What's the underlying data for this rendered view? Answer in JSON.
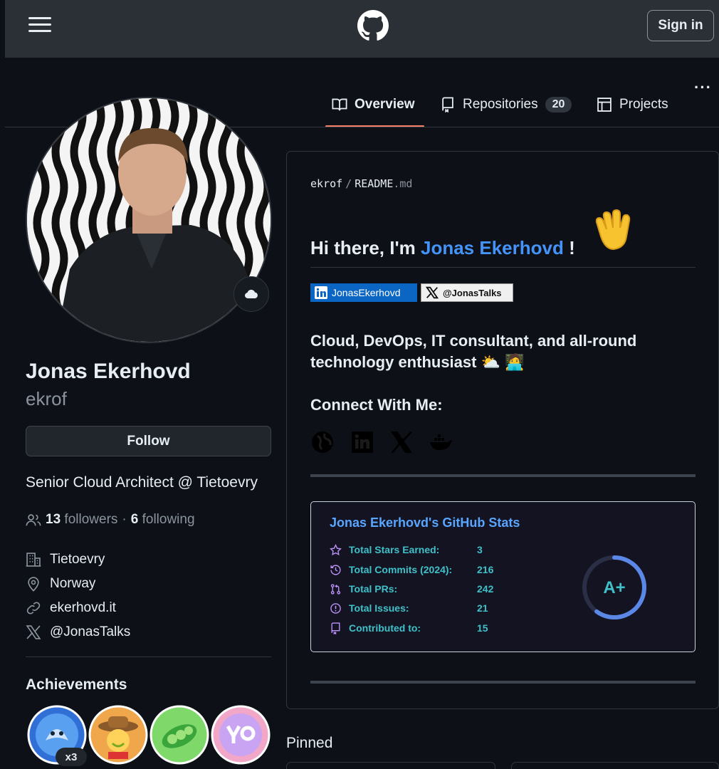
{
  "header": {
    "signin_label": "Sign in"
  },
  "tabs": [
    {
      "label": "Overview",
      "active": true,
      "icon": "book-icon"
    },
    {
      "label": "Repositories",
      "count": "20",
      "icon": "repo-icon"
    },
    {
      "label": "Projects",
      "icon": "table-icon"
    }
  ],
  "more_menu": "···",
  "profile": {
    "name": "Jonas Ekerhovd",
    "login": "ekrof",
    "follow_label": "Follow",
    "bio": "Senior Cloud Architect @ Tietoevry",
    "followers_count": "13",
    "followers_label": "followers",
    "dot": "·",
    "following_count": "6",
    "following_label": "following",
    "company": "Tietoevry",
    "location": "Norway",
    "website": "ekerhovd.it",
    "twitter": "@JonasTalks",
    "achievements_title": "Achievements",
    "achievement_multiplier": "x3"
  },
  "readme": {
    "path_user": "ekrof",
    "path_slash": "/",
    "path_file": "README",
    "path_ext": ".md",
    "hello_prefix": "Hi there, I'm ",
    "hello_name": "Jonas Ekerhovd",
    "hello_suffix": " !",
    "linkedin_badge": "JonasEkerhovd",
    "x_badge": "@JonasTalks",
    "tagline": "Cloud, DevOps, IT consultant, and all-round technology enthusiast ⛅ 🧑‍💻",
    "connect_title": "Connect With Me:"
  },
  "stats": {
    "title": "Jonas Ekerhovd's GitHub Stats",
    "rows": [
      {
        "label": "Total Stars Earned:",
        "value": "3",
        "icon": "star-icon"
      },
      {
        "label": "Total Commits (2024):",
        "value": "216",
        "icon": "history-icon"
      },
      {
        "label": "Total PRs:",
        "value": "242",
        "icon": "pull-request-icon"
      },
      {
        "label": "Total Issues:",
        "value": "21",
        "icon": "issue-icon"
      },
      {
        "label": "Contributed to:",
        "value": "15",
        "icon": "repo-icon"
      }
    ],
    "grade": "A+",
    "grade_progress": 0.6
  },
  "pinned_title": "Pinned",
  "colors": {
    "accent_link": "#4493f8",
    "tab_underline": "#f78166",
    "stats_title": "#58a6ff",
    "stats_text": "#3fc1c9",
    "linkedin": "#0a66c2"
  }
}
